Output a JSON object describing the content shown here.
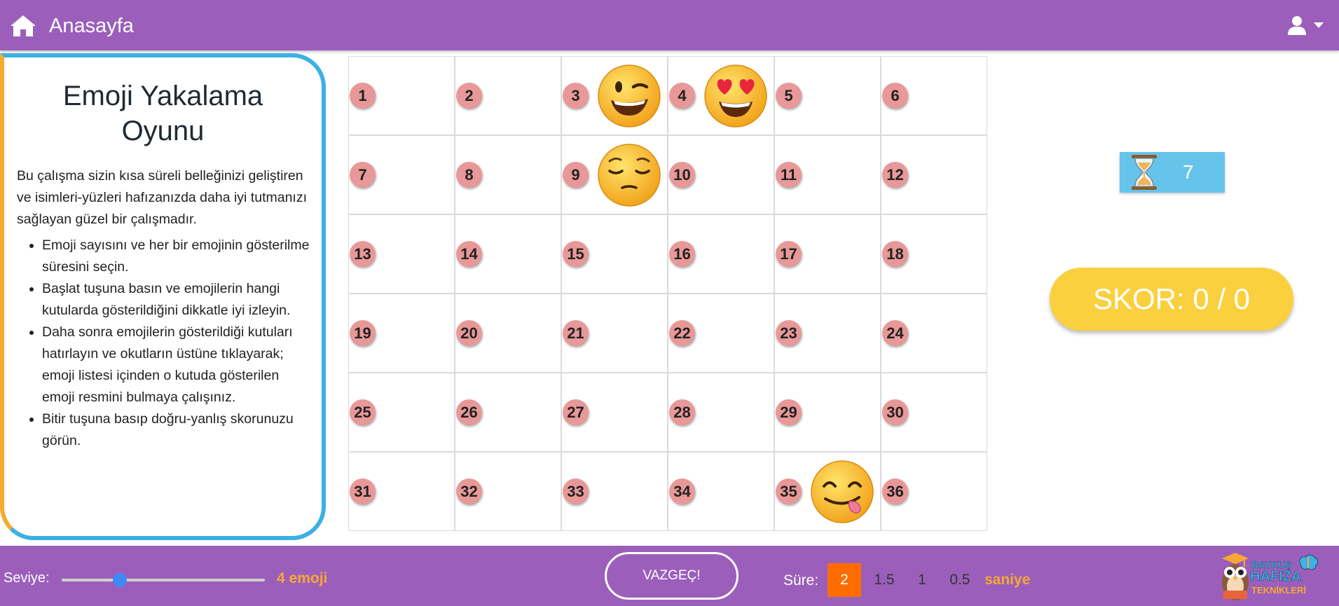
{
  "header": {
    "home_label": "Anasayfa"
  },
  "info": {
    "title": "Emoji Yakalama Oyunu",
    "intro": "Bu çalışma sizin kısa süreli belleğinizi geliştiren ve isimleri-yüzleri hafızanızda daha iyi tutmanızı sağlayan güzel bir çalışmadır.",
    "steps": [
      "Emoji sayısını ve her bir emojinin gösterilme süresini seçin.",
      "Başlat tuşuna basın ve emojilerin hangi kutularda gösterildiğini dikkatle iyi izleyin.",
      "Daha sonra emojilerin gösterildiği kutuları hatırlayın ve okutların üstüne tıklayarak; emoji listesi içinden o kutuda gösterilen emoji resmini bulmaya çalışınız.",
      "Bitir tuşuna basıp doğru-yanlış skorunuzu görün."
    ]
  },
  "grid": {
    "cells": [
      "1",
      "2",
      "3",
      "4",
      "5",
      "6",
      "7",
      "8",
      "9",
      "10",
      "11",
      "12",
      "13",
      "14",
      "15",
      "16",
      "17",
      "18",
      "19",
      "20",
      "21",
      "22",
      "23",
      "24",
      "25",
      "26",
      "27",
      "28",
      "29",
      "30",
      "31",
      "32",
      "33",
      "34",
      "35",
      "36"
    ],
    "emojis": [
      {
        "cell": 3,
        "icon": "winking-face-emoji"
      },
      {
        "cell": 4,
        "icon": "heart-eyes-emoji"
      },
      {
        "cell": 9,
        "icon": "relieved-face-emoji"
      },
      {
        "cell": 35,
        "icon": "yum-face-emoji"
      }
    ]
  },
  "timer": {
    "value": "7",
    "icon": "hourglass-icon"
  },
  "score": {
    "label": "SKOR: 0 / 0"
  },
  "footer": {
    "level_label": "Seviye:",
    "level_fraction": 0.27,
    "level_value": "4 emoji",
    "cancel_label": "VAZGEÇ!",
    "duration_label": "Süre:",
    "duration_options": [
      "2",
      "1.5",
      "1",
      "0.5"
    ],
    "duration_selected": "2",
    "duration_unit": "saniye"
  },
  "logo": {
    "line1": "BAYKUŞ",
    "line2": "HAFIZA",
    "line3": "TEKNİKLERİ"
  },
  "colors": {
    "purple": "#9b5fbb",
    "orange": "#f7a833",
    "blue": "#3db0e4",
    "yellow": "#fbd03e",
    "badge": "#e89898",
    "active": "#ff6d00"
  }
}
